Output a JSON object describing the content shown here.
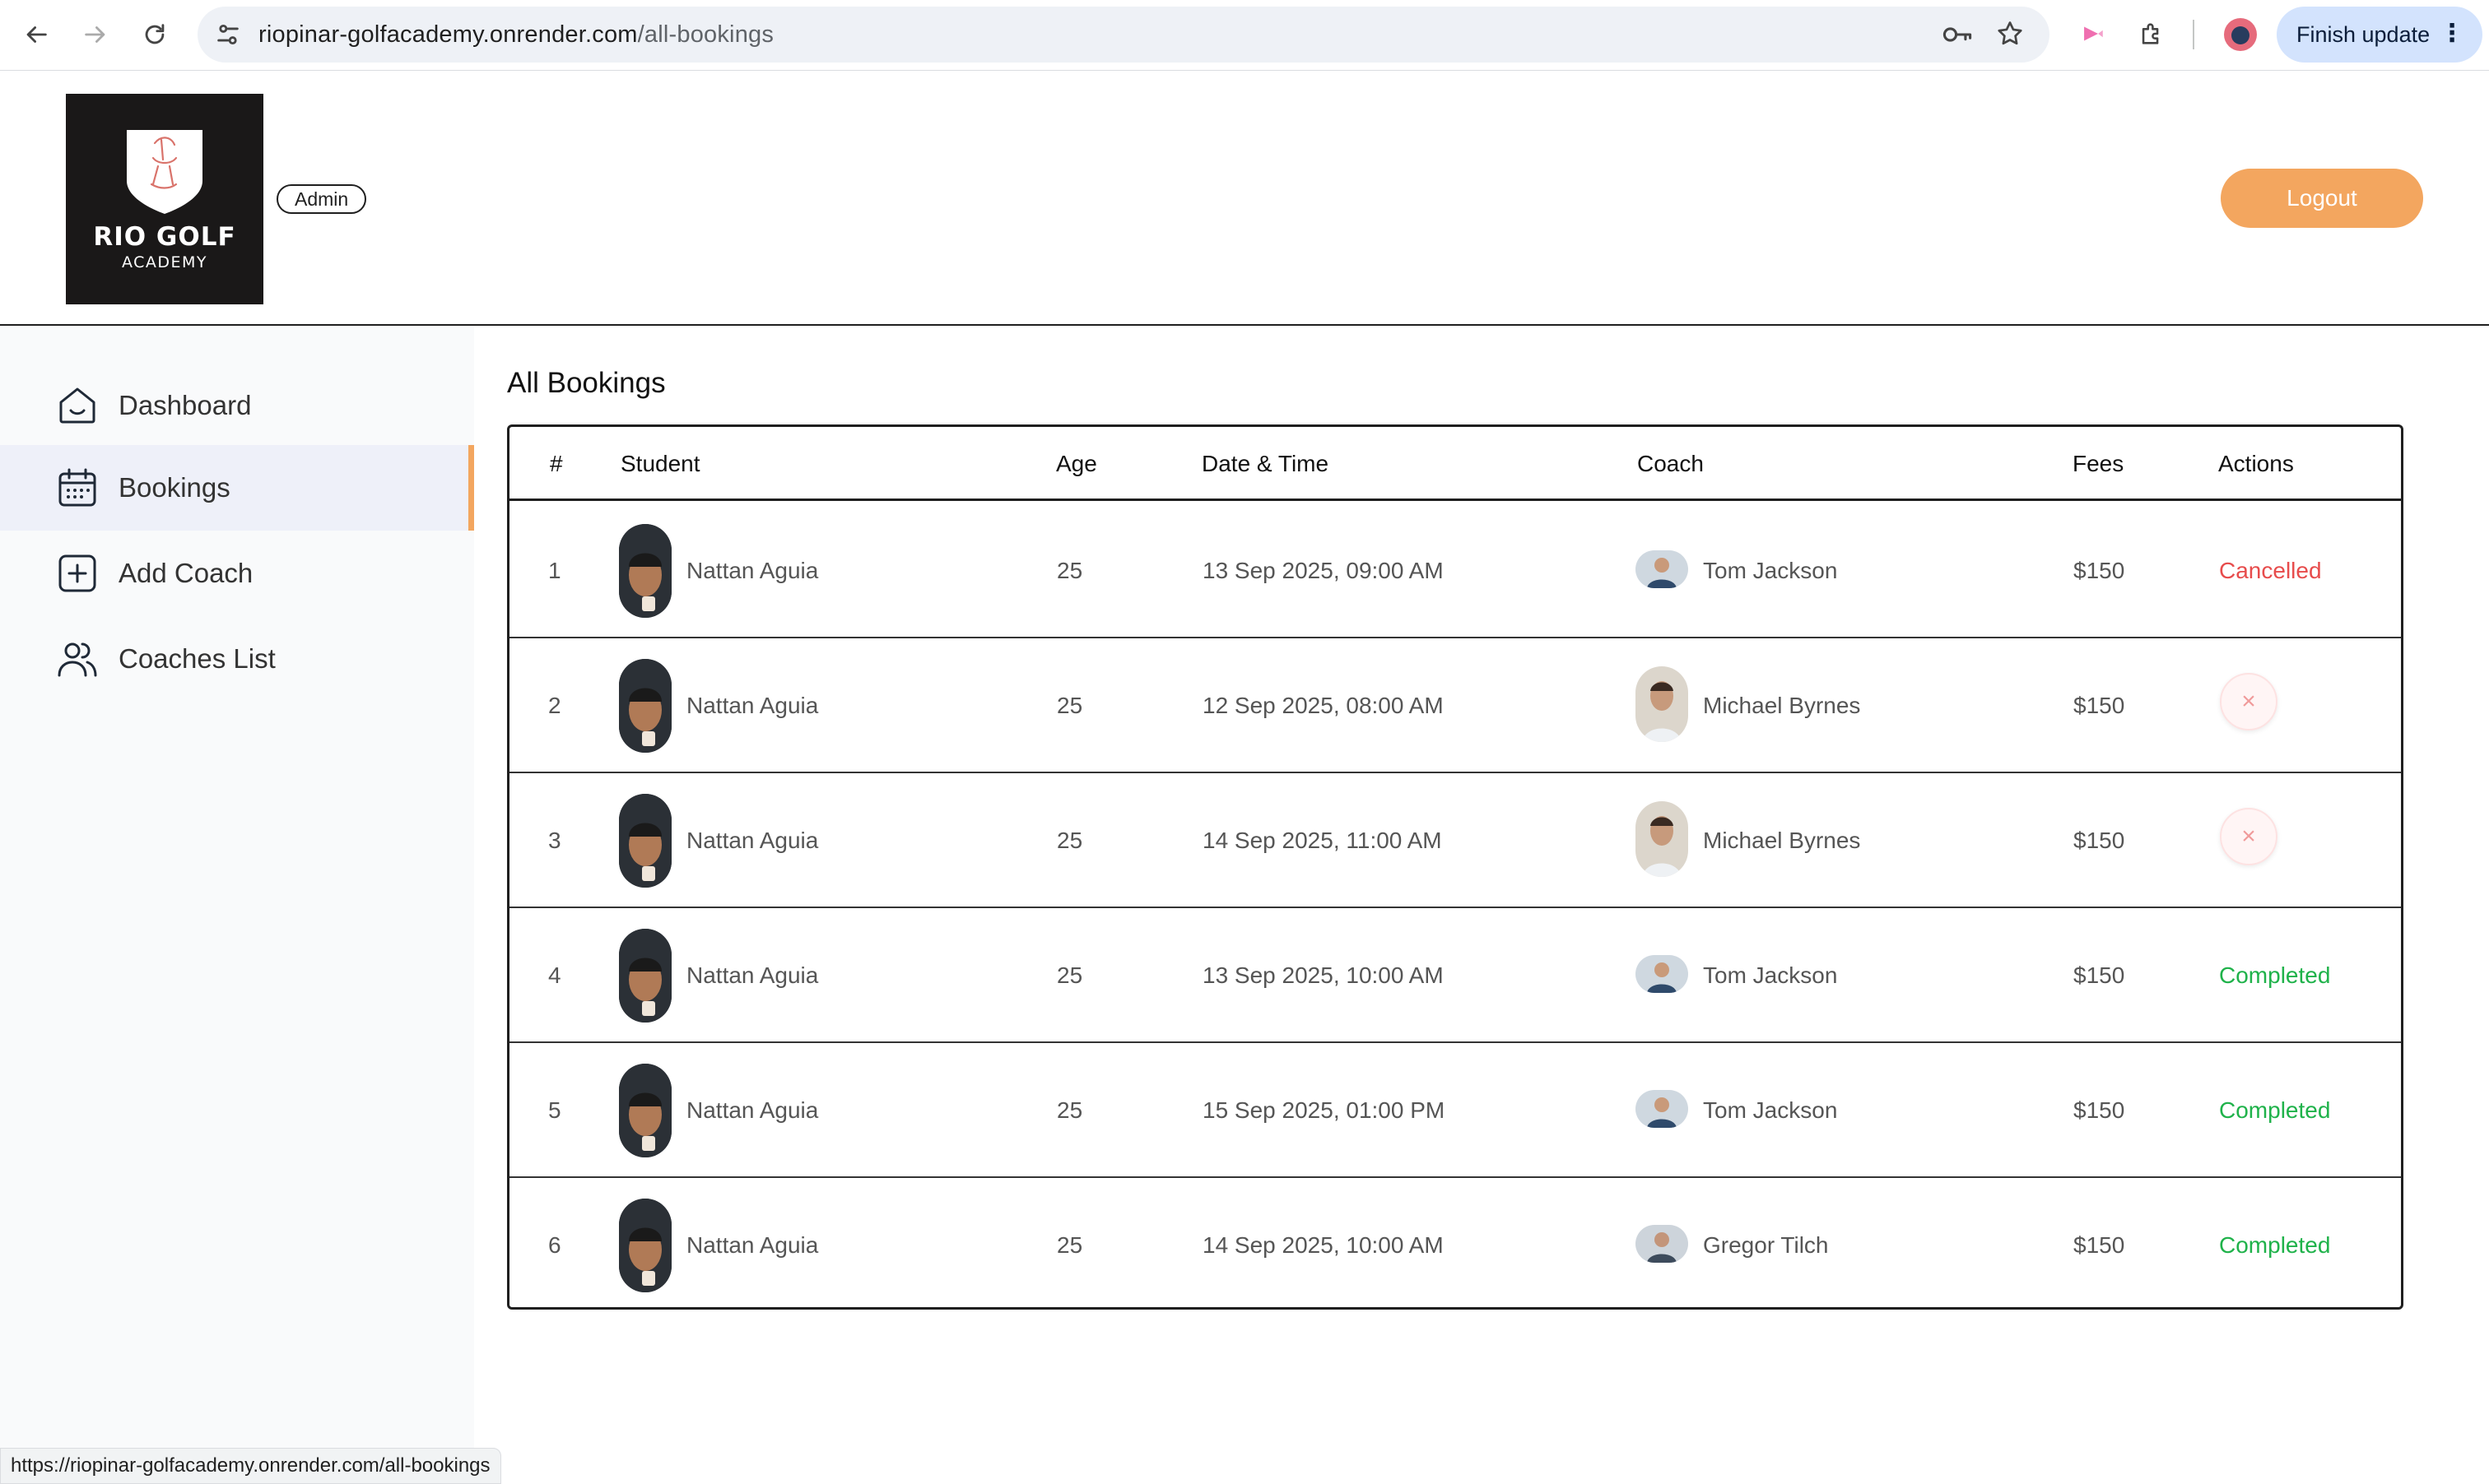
{
  "browser": {
    "url_host": "riopinar-golfacademy.onrender.com",
    "url_path": "/all-bookings",
    "finish_update_label": "Finish update",
    "status_url": "https://riopinar-golfacademy.onrender.com/all-bookings"
  },
  "header": {
    "logo_line1": "RIO GOLF",
    "logo_line2": "ACADEMY",
    "role_badge": "Admin",
    "logout_label": "Logout"
  },
  "sidebar": {
    "items": [
      {
        "label": "Dashboard",
        "icon": "home-icon"
      },
      {
        "label": "Bookings",
        "icon": "calendar-icon",
        "active": true
      },
      {
        "label": "Add Coach",
        "icon": "plus-square-icon"
      },
      {
        "label": "Coaches List",
        "icon": "users-icon"
      }
    ]
  },
  "main": {
    "title": "All Bookings",
    "columns": [
      "#",
      "Student",
      "Age",
      "Date & Time",
      "Coach",
      "Fees",
      "Actions"
    ],
    "rows": [
      {
        "num": "1",
        "student": "Nattan Aguia",
        "age": "25",
        "datetime": "13 Sep 2025, 09:00 AM",
        "coach": "Tom Jackson",
        "fees": "$150",
        "action": "Cancelled"
      },
      {
        "num": "2",
        "student": "Nattan Aguia",
        "age": "25",
        "datetime": "12 Sep 2025, 08:00 AM",
        "coach": "Michael Byrnes",
        "fees": "$150",
        "action": "×"
      },
      {
        "num": "3",
        "student": "Nattan Aguia",
        "age": "25",
        "datetime": "14 Sep 2025, 11:00 AM",
        "coach": "Michael Byrnes",
        "fees": "$150",
        "action": "×"
      },
      {
        "num": "4",
        "student": "Nattan Aguia",
        "age": "25",
        "datetime": "13 Sep 2025, 10:00 AM",
        "coach": "Tom Jackson",
        "fees": "$150",
        "action": "Completed"
      },
      {
        "num": "5",
        "student": "Nattan Aguia",
        "age": "25",
        "datetime": "15 Sep 2025, 01:00 PM",
        "coach": "Tom Jackson",
        "fees": "$150",
        "action": "Completed"
      },
      {
        "num": "6",
        "student": "Nattan Aguia",
        "age": "25",
        "datetime": "14 Sep 2025, 10:00 AM",
        "coach": "Gregor Tilch",
        "fees": "$150",
        "action": "Completed"
      }
    ]
  },
  "colors": {
    "accent": "#f3a65f",
    "cancelled": "#e74c4c",
    "completed": "#1fb24a"
  }
}
